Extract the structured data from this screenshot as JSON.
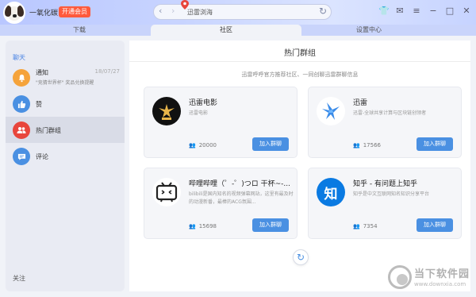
{
  "titlebar": {
    "username": "一氧化碳",
    "vip_label": "开通会员",
    "address": "迅雷浏海"
  },
  "tabs": [
    {
      "label": "下载"
    },
    {
      "label": "社区"
    },
    {
      "label": "设置中心"
    }
  ],
  "sidebar": {
    "section_title": "聊天",
    "items": [
      {
        "label": "通知",
        "date": "18/07/27",
        "sub": "\"竞猜世界杯\" 奖品兑换提醒",
        "icon": "bell-icon",
        "color": "#f5a33b"
      },
      {
        "label": "赞",
        "icon": "thumbs-up-icon",
        "color": "#4a90e2"
      },
      {
        "label": "热门群组",
        "icon": "group-icon",
        "color": "#e8463c"
      },
      {
        "label": "评论",
        "icon": "comment-icon",
        "color": "#4a90e2"
      }
    ],
    "footer": "关注"
  },
  "main": {
    "title": "热门群组",
    "description": "迅雷呼呼官方推荐社区、一同创聊迅雷群聊信息",
    "groups": [
      {
        "name": "迅雷电影",
        "desc": "迅雷电影",
        "members": "20000",
        "join": "加入群聊",
        "logo": "xunlei-movie-logo"
      },
      {
        "name": "迅雷",
        "desc": "迅雷-全球共享计算与区块链创领者",
        "members": "17566",
        "join": "加入群聊",
        "logo": "xunlei-bird-logo"
      },
      {
        "name": "哔哩哔哩（゜-゜)つロ 干杯~-...",
        "desc": "bilibili是国内知名的视频弹幕网站，这里有最及时的动漫新番，最棒的ACG氛围...",
        "members": "15698",
        "join": "加入群聊",
        "logo": "bilibili-tv-logo"
      },
      {
        "name": "知乎 - 有问题上知乎",
        "desc": "知乎是中文互联网知名知识分享平台",
        "members": "7354",
        "join": "加入群聊",
        "logo": "zhihu-logo"
      }
    ],
    "reload_icon": "refresh-icon"
  },
  "watermark": {
    "text": "当下软件园",
    "url": "www.downxia.com"
  },
  "colors": {
    "accent": "#4a90e2",
    "vip": "#ff5a3c",
    "titlebar": "#c6d3ff"
  }
}
